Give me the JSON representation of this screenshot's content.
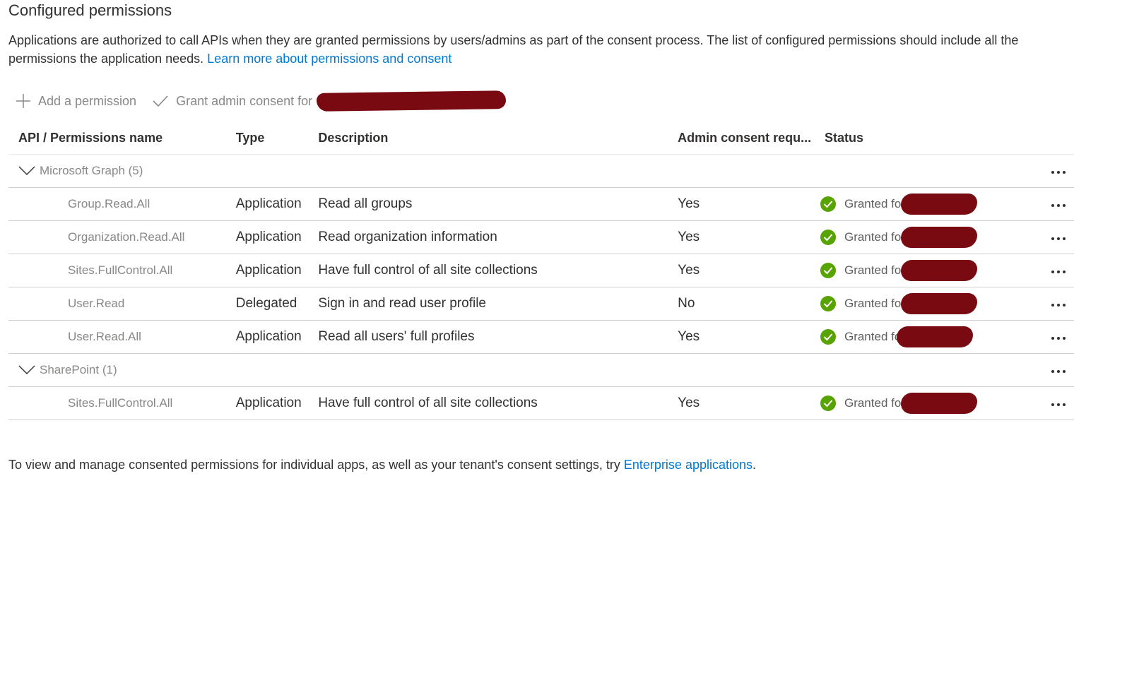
{
  "section": {
    "title": "Configured permissions",
    "intro_text": "Applications are authorized to call APIs when they are granted permissions by users/admins as part of the consent process. The list of configured permissions should include all the permissions the application needs.",
    "intro_link": "Learn more about permissions and consent"
  },
  "toolbar": {
    "add_label": "Add a permission",
    "grant_label": "Grant admin consent for"
  },
  "table": {
    "headers": {
      "name": "API / Permissions name",
      "type": "Type",
      "description": "Description",
      "admin": "Admin consent requ...",
      "status": "Status"
    },
    "groups": [
      {
        "label": "Microsoft Graph (5)",
        "rows": [
          {
            "name": "Group.Read.All",
            "type": "Application",
            "description": "Read all groups",
            "admin": "Yes",
            "status": "Granted for"
          },
          {
            "name": "Organization.Read.All",
            "type": "Application",
            "description": "Read organization information",
            "admin": "Yes",
            "status": "Granted for"
          },
          {
            "name": "Sites.FullControl.All",
            "type": "Application",
            "description": "Have full control of all site collections",
            "admin": "Yes",
            "status": "Granted for"
          },
          {
            "name": "User.Read",
            "type": "Delegated",
            "description": "Sign in and read user profile",
            "admin": "No",
            "status": "Granted for"
          },
          {
            "name": "User.Read.All",
            "type": "Application",
            "description": "Read all users' full profiles",
            "admin": "Yes",
            "status": "Granted fo"
          }
        ]
      },
      {
        "label": "SharePoint (1)",
        "rows": [
          {
            "name": "Sites.FullControl.All",
            "type": "Application",
            "description": "Have full control of all site collections",
            "admin": "Yes",
            "status": "Granted for"
          }
        ]
      }
    ]
  },
  "footer": {
    "text": "To view and manage consented permissions for individual apps, as well as your tenant's consent settings, try",
    "link": "Enterprise applications",
    "suffix": "."
  },
  "colors": {
    "link": "#0078d4",
    "granted": "#57a300",
    "redaction": "#7a0a12"
  }
}
